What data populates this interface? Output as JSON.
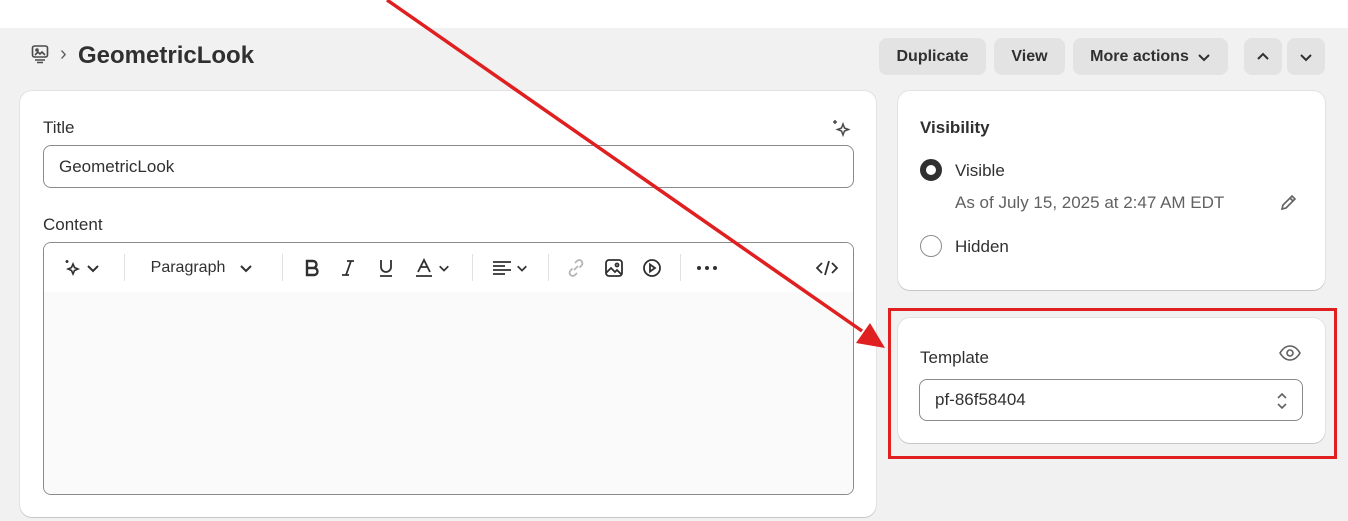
{
  "header": {
    "page_title": "GeometricLook",
    "breadcrumb_separator": "›",
    "page_icon": "page-icon",
    "buttons": {
      "duplicate": "Duplicate",
      "view": "View",
      "more_actions": "More actions"
    }
  },
  "main": {
    "title_label": "Title",
    "title_value": "GeometricLook",
    "content_label": "Content",
    "toolbar": {
      "paragraph_label": "Paragraph",
      "icons": [
        "ai-sparkle-icon",
        "bold-icon",
        "italic-icon",
        "underline-icon",
        "text-color-icon",
        "align-icon",
        "link-icon",
        "image-icon",
        "video-icon",
        "more-icon",
        "code-icon"
      ]
    }
  },
  "visibility": {
    "heading": "Visibility",
    "visible_label": "Visible",
    "visible_note": "As of July 15, 2025 at 2:47 AM EDT",
    "hidden_label": "Hidden",
    "selected": "Visible"
  },
  "template": {
    "label": "Template",
    "selected_value": "pf-86f58404"
  },
  "colors": {
    "annotation": "#e02020",
    "background": "#f1f1f1",
    "card": "#ffffff",
    "button": "#e3e3e3"
  }
}
